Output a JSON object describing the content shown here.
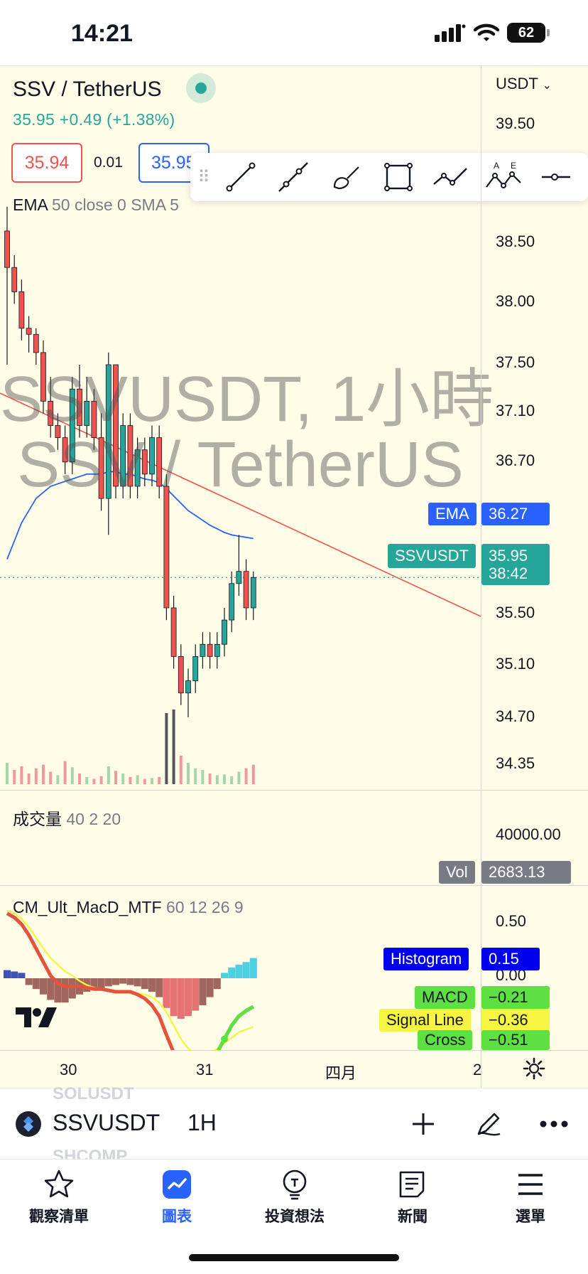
{
  "status_bar": {
    "time": "14:21",
    "battery": "62"
  },
  "header": {
    "symbol_title": "SSV / TetherUS",
    "price_line": "35.95  +0.49 (+1.38%)",
    "bid": "35.94",
    "spread": "0.01",
    "ask": "35.95"
  },
  "indicators": {
    "ema_legend_name": "EMA",
    "ema_legend_args": "50 close 0 SMA 5",
    "volume_name": "成交量",
    "volume_args": "40 2 20",
    "macd_name": "CM_Ult_MacD_MTF",
    "macd_args": "60 12 26 9"
  },
  "watermark": {
    "line1": "SSVUSDT, 1小時",
    "line2": "SSV / TetherUS"
  },
  "price_axis": {
    "currency": "USDT",
    "ticks": [
      "39.50",
      "38.50",
      "38.00",
      "37.50",
      "37.10",
      "36.70",
      "35.50",
      "35.10",
      "34.70",
      "34.35"
    ],
    "volume_ticks": [
      "40000.00"
    ],
    "macd_ticks": [
      "0.50",
      "0.00"
    ]
  },
  "axis_tags": {
    "ema": {
      "label": "EMA",
      "value": "36.27",
      "color": "#2962ff"
    },
    "last": {
      "label": "SSVUSDT",
      "value": "35.95",
      "countdown": "38:42",
      "color": "#26a69a"
    },
    "vol": {
      "label": "Vol",
      "value": "2683.13",
      "color": "#787b86"
    },
    "histogram": {
      "label": "Histogram",
      "value": "0.15",
      "color": "#0000ee"
    },
    "macd": {
      "label": "MACD",
      "value": "−0.21",
      "color": "#5ee043"
    },
    "signal": {
      "label": "Signal Line",
      "value": "−0.36",
      "color": "#f5f542"
    },
    "cross": {
      "label": "Cross",
      "value": "−0.51",
      "color": "#5ee043"
    }
  },
  "time_axis": [
    "30",
    "31",
    "四月",
    "2"
  ],
  "symbol_bar": {
    "ghost_top": "SOLUSDT",
    "ghost_bottom": "SHCOMP",
    "symbol": "SSVUSDT",
    "interval": "1H"
  },
  "drawing_tools": [
    "trend-line",
    "ray",
    "brush",
    "rectangle",
    "path",
    "elliott-wave",
    "horizontal-ray"
  ],
  "nav": [
    {
      "label": "觀察清單",
      "icon": "star-icon"
    },
    {
      "label": "圖表",
      "icon": "chart-icon",
      "active": true
    },
    {
      "label": "投資想法",
      "icon": "idea-icon"
    },
    {
      "label": "新聞",
      "icon": "news-icon"
    },
    {
      "label": "選單",
      "icon": "menu-icon"
    }
  ],
  "colors": {
    "up": "#26a69a",
    "down": "#ef5350",
    "ema": "#2962ff",
    "trendline": "#ef5350",
    "background": "#fffde8"
  },
  "chart_data": {
    "type": "candlestick",
    "candles": [
      [
        38.8,
        39.0,
        37.7,
        38.5
      ],
      [
        38.5,
        38.6,
        38.2,
        38.3
      ],
      [
        38.3,
        38.4,
        37.9,
        38.0
      ],
      [
        38.0,
        38.1,
        37.8,
        37.95
      ],
      [
        37.95,
        38.0,
        37.7,
        37.8
      ],
      [
        37.8,
        37.9,
        37.3,
        37.4
      ],
      [
        37.4,
        37.6,
        37.1,
        37.2
      ],
      [
        37.2,
        37.3,
        37.0,
        37.1
      ],
      [
        37.1,
        37.2,
        36.8,
        36.9
      ],
      [
        36.9,
        37.6,
        36.8,
        37.5
      ],
      [
        37.5,
        37.7,
        37.1,
        37.2
      ],
      [
        37.2,
        37.6,
        37.1,
        37.4
      ],
      [
        37.4,
        37.5,
        37.0,
        37.1
      ],
      [
        37.1,
        37.3,
        36.5,
        36.6
      ],
      [
        36.6,
        37.8,
        36.3,
        37.7
      ],
      [
        37.7,
        37.7,
        36.6,
        36.7
      ],
      [
        36.7,
        37.3,
        36.6,
        37.2
      ],
      [
        37.2,
        37.3,
        36.6,
        36.7
      ],
      [
        36.7,
        37.1,
        36.6,
        37.0
      ],
      [
        37.0,
        37.1,
        36.7,
        36.8
      ],
      [
        36.8,
        37.2,
        36.7,
        37.1
      ],
      [
        37.1,
        37.2,
        36.6,
        36.7
      ],
      [
        36.7,
        36.8,
        35.6,
        35.7
      ],
      [
        35.7,
        35.8,
        35.2,
        35.3
      ],
      [
        35.3,
        35.4,
        34.9,
        35.0
      ],
      [
        35.0,
        35.2,
        34.8,
        35.1
      ],
      [
        35.1,
        35.4,
        35.0,
        35.3
      ],
      [
        35.3,
        35.5,
        35.2,
        35.4
      ],
      [
        35.4,
        35.5,
        35.2,
        35.3
      ],
      [
        35.3,
        35.5,
        35.2,
        35.4
      ],
      [
        35.4,
        35.7,
        35.3,
        35.6
      ],
      [
        35.6,
        36.0,
        35.5,
        35.9
      ],
      [
        35.9,
        36.3,
        35.8,
        36.0
      ],
      [
        36.0,
        36.1,
        35.6,
        35.7
      ],
      [
        35.7,
        36.0,
        35.6,
        35.95
      ]
    ],
    "ema": [
      36.1,
      36.25,
      36.4,
      36.5,
      36.6,
      36.65,
      36.7,
      36.72,
      36.74,
      36.76,
      36.78,
      36.8,
      36.8,
      36.8,
      36.82,
      36.82,
      36.8,
      36.8,
      36.78,
      36.76,
      36.75,
      36.73,
      36.68,
      36.62,
      36.56,
      36.5,
      36.46,
      36.42,
      36.38,
      36.35,
      36.32,
      36.3,
      36.29,
      36.28,
      36.27
    ],
    "trendline": {
      "start": 36.55,
      "end": 35.55
    },
    "volume": [
      120,
      80,
      100,
      60,
      90,
      110,
      70,
      50,
      130,
      95,
      60,
      40,
      30,
      45,
      100,
      75,
      60,
      40,
      50,
      30,
      35,
      40,
      400,
      420,
      160,
      120,
      90,
      80,
      60,
      50,
      55,
      45,
      70,
      90,
      110
    ],
    "volume_up": [
      true,
      false,
      false,
      false,
      false,
      false,
      false,
      true,
      false,
      true,
      false,
      true,
      false,
      false,
      true,
      false,
      true,
      false,
      true,
      false,
      true,
      false,
      false,
      false,
      false,
      true,
      true,
      true,
      false,
      true,
      true,
      true,
      true,
      false,
      false
    ],
    "macd_hist": [
      0.06,
      0.05,
      0.04,
      -0.05,
      -0.08,
      -0.12,
      -0.16,
      -0.18,
      -0.18,
      -0.15,
      -0.12,
      -0.1,
      -0.08,
      -0.08,
      -0.06,
      -0.05,
      -0.04,
      -0.05,
      -0.06,
      -0.08,
      -0.1,
      -0.14,
      -0.22,
      -0.28,
      -0.3,
      -0.28,
      -0.24,
      -0.2,
      -0.14,
      -0.08,
      0.04,
      0.08,
      0.1,
      0.12,
      0.15
    ],
    "macd_line": [
      0.48,
      0.45,
      0.4,
      0.32,
      0.22,
      0.12,
      0.02,
      -0.04,
      -0.06,
      -0.06,
      -0.06,
      -0.07,
      -0.08,
      -0.08,
      -0.09,
      -0.1,
      -0.1,
      -0.1,
      -0.12,
      -0.15,
      -0.2,
      -0.28,
      -0.42,
      -0.55,
      -0.63,
      -0.66,
      -0.66,
      -0.65,
      -0.6,
      -0.55,
      -0.45,
      -0.35,
      -0.28,
      -0.24,
      -0.21
    ],
    "signal_line": [
      0.5,
      0.48,
      0.44,
      0.38,
      0.3,
      0.22,
      0.15,
      0.1,
      0.05,
      0.02,
      -0.02,
      -0.05,
      -0.07,
      -0.08,
      -0.09,
      -0.1,
      -0.1,
      -0.1,
      -0.11,
      -0.12,
      -0.14,
      -0.18,
      -0.25,
      -0.35,
      -0.45,
      -0.52,
      -0.56,
      -0.58,
      -0.56,
      -0.52,
      -0.48,
      -0.44,
      -0.4,
      -0.38,
      -0.36
    ]
  }
}
